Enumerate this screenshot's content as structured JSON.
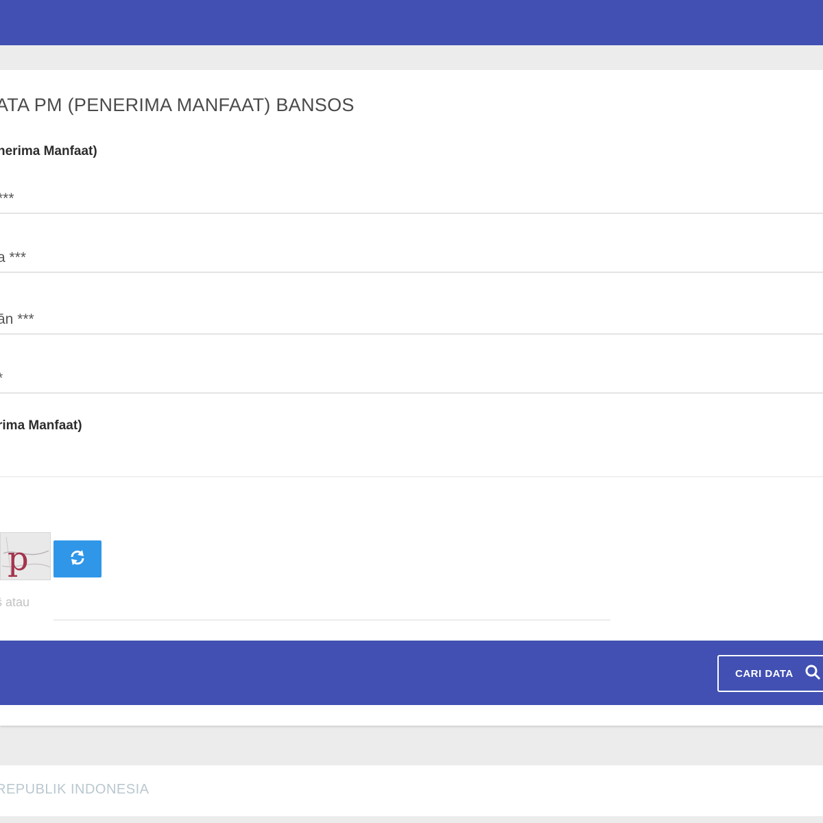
{
  "form": {
    "title": "ATA PM (PENERIMA MANFAAT) BANSOS",
    "location_label": "nerima Manfaat)",
    "fields": [
      {
        "value": "***"
      },
      {
        "value": "a ***"
      },
      {
        "value": "ān ***"
      },
      {
        "value": "*"
      }
    ],
    "name_label": "rima Manfaat)",
    "name_value": ""
  },
  "captcha": {
    "image_text": "p",
    "hint": "ŝ atau"
  },
  "actions": {
    "search_label": "CARI DATA"
  },
  "footer": {
    "text": "REPUBLIK INDONESIA"
  },
  "colors": {
    "primary": "#4150b2",
    "refresh_button": "#2f96e8",
    "background": "#ececec"
  },
  "icons": {
    "refresh": "refresh-icon",
    "search": "search-icon"
  }
}
